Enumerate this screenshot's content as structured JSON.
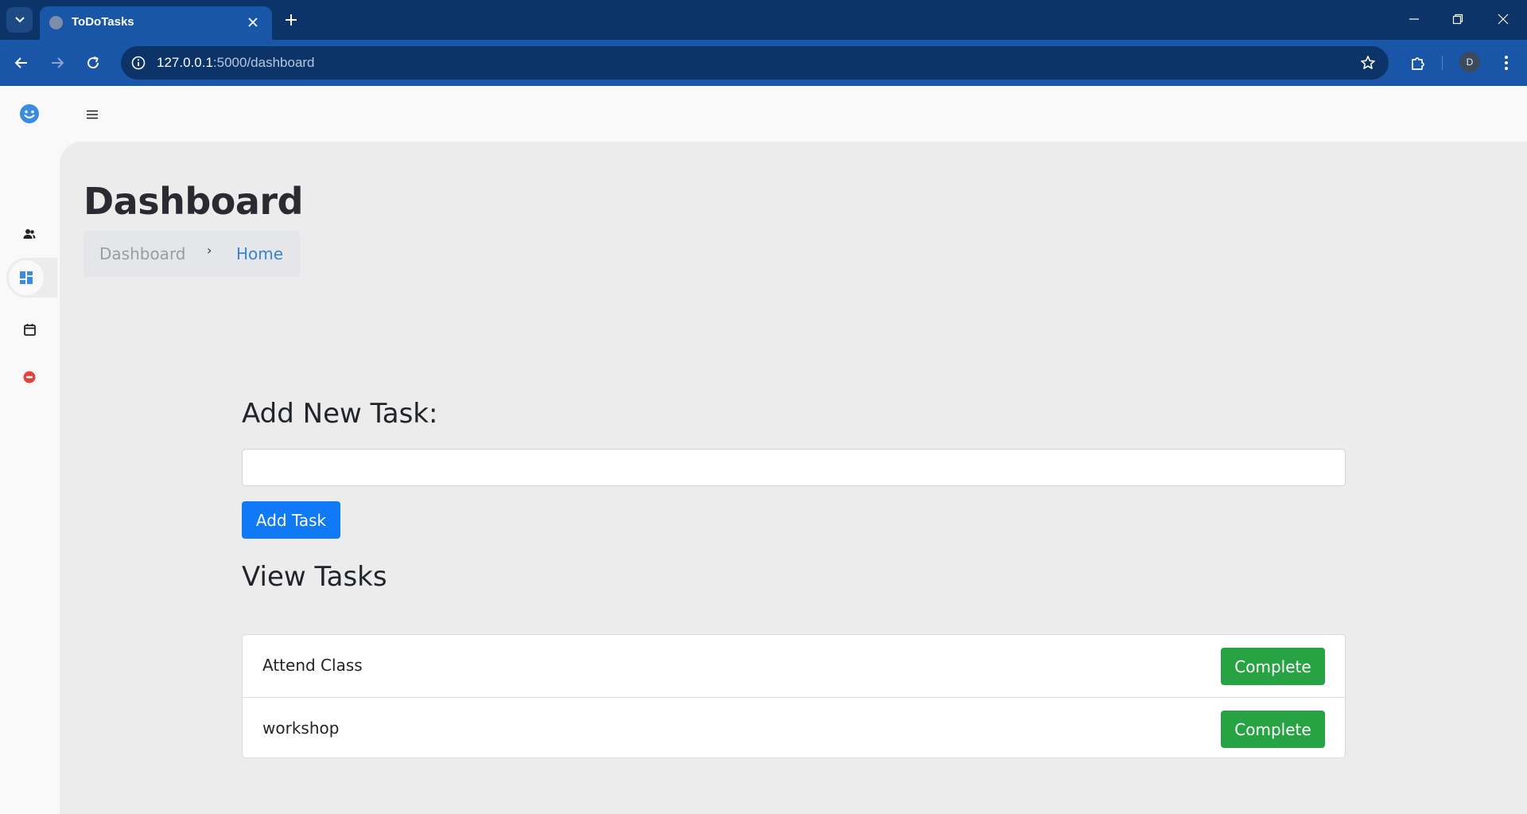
{
  "browser": {
    "tab_title": "ToDoTasks",
    "url_host": "127.0.0.1",
    "url_path": ":5000/dashboard",
    "profile_initial": "D"
  },
  "header": {
    "logo_icon": "smiley-icon",
    "menu_icon": "hamburger-icon"
  },
  "sidebar": {
    "items": [
      {
        "icon": "users-icon",
        "active": false
      },
      {
        "icon": "dashboard-icon",
        "active": true
      },
      {
        "icon": "calendar-icon",
        "active": false
      },
      {
        "icon": "logout-icon",
        "active": false
      }
    ]
  },
  "page": {
    "title": "Dashboard",
    "breadcrumb": {
      "parent": "Dashboard",
      "separator": "›",
      "current": "Home"
    }
  },
  "add_task": {
    "heading": "Add New Task:",
    "input_value": "",
    "input_placeholder": "",
    "button_label": "Add Task"
  },
  "view_tasks": {
    "heading": "View Tasks",
    "tasks": [
      {
        "name": "Attend Class",
        "action": "Complete"
      },
      {
        "name": "workshop",
        "action": "Complete"
      }
    ]
  },
  "colors": {
    "accent": "#1079f6",
    "complete": "#27a344",
    "browser_frame": "#1a56a8"
  }
}
